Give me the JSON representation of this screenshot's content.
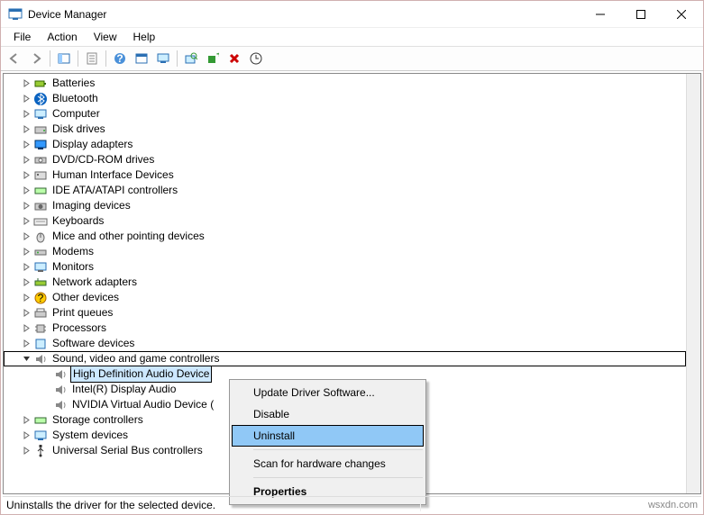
{
  "window": {
    "title": "Device Manager"
  },
  "menu": {
    "file": "File",
    "action": "Action",
    "view": "View",
    "help": "Help"
  },
  "toolbar_icons": [
    "back",
    "forward",
    "show-hide-console-tree",
    "properties",
    "help",
    "action-refresh",
    "action-computer",
    "scan-hardware",
    "add-legacy",
    "uninstall",
    "update-driver"
  ],
  "tree": {
    "batteries": "Batteries",
    "bluetooth": "Bluetooth",
    "computer": "Computer",
    "disk_drives": "Disk drives",
    "display_adapters": "Display adapters",
    "dvd": "DVD/CD-ROM drives",
    "hid": "Human Interface Devices",
    "ide": "IDE ATA/ATAPI controllers",
    "imaging": "Imaging devices",
    "keyboards": "Keyboards",
    "mice": "Mice and other pointing devices",
    "modems": "Modems",
    "monitors": "Monitors",
    "network": "Network adapters",
    "other": "Other devices",
    "printq": "Print queues",
    "processors": "Processors",
    "software": "Software devices",
    "sound": "Sound, video and game controllers",
    "sound_children": {
      "hd_audio": "High Definition Audio Device",
      "intel_audio": "Intel(R) Display Audio",
      "nvidia_audio": "NVIDIA Virtual Audio Device ("
    },
    "storage": "Storage controllers",
    "system": "System devices",
    "usb": "Universal Serial Bus controllers"
  },
  "context_menu": {
    "update": "Update Driver Software...",
    "disable": "Disable",
    "uninstall": "Uninstall",
    "scan": "Scan for hardware changes",
    "properties": "Properties"
  },
  "status": {
    "text": "Uninstalls the driver for the selected device."
  },
  "watermark": "wsxdn.com"
}
